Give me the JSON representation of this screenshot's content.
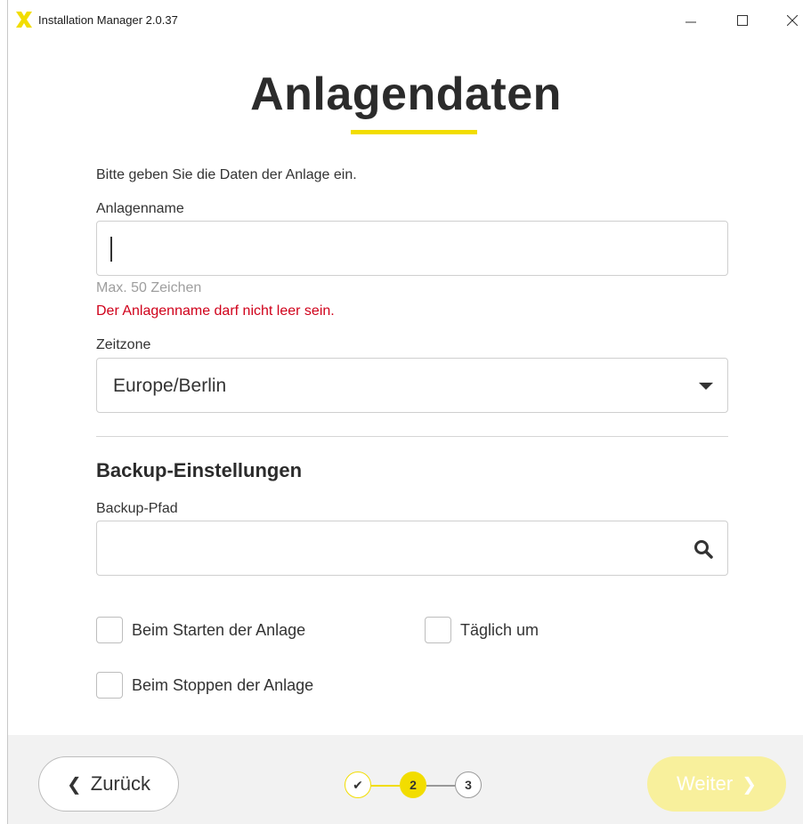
{
  "window": {
    "title": "Installation Manager 2.0.37",
    "controls": {
      "minimize": "minimize-icon",
      "maximize": "maximize-icon",
      "close": "close-icon"
    }
  },
  "page": {
    "title": "Anlagendaten",
    "intro": "Bitte geben Sie die Daten der Anlage ein."
  },
  "form": {
    "name_label": "Anlagenname",
    "name_value": "",
    "name_hint": "Max. 50 Zeichen",
    "name_error": "Der Anlagenname darf nicht leer sein.",
    "timezone_label": "Zeitzone",
    "timezone_value": "Europe/Berlin"
  },
  "backup": {
    "section_title": "Backup-Einstellungen",
    "path_label": "Backup-Pfad",
    "path_value": "",
    "options": [
      {
        "label": "Beim Starten der Anlage",
        "checked": false
      },
      {
        "label": "Täglich um",
        "checked": false
      },
      {
        "label": "Beim Stoppen der Anlage",
        "checked": false
      }
    ]
  },
  "footer": {
    "back_label": "Zurück",
    "next_label": "Weiter",
    "steps": [
      {
        "label": "✔",
        "state": "done"
      },
      {
        "label": "2",
        "state": "current"
      },
      {
        "label": "3",
        "state": "pending"
      }
    ]
  },
  "colors": {
    "accent": "#f2dd00",
    "error": "#d0021b",
    "next_disabled_bg": "#f8f09c",
    "footer_bg": "#f2f2f2"
  }
}
